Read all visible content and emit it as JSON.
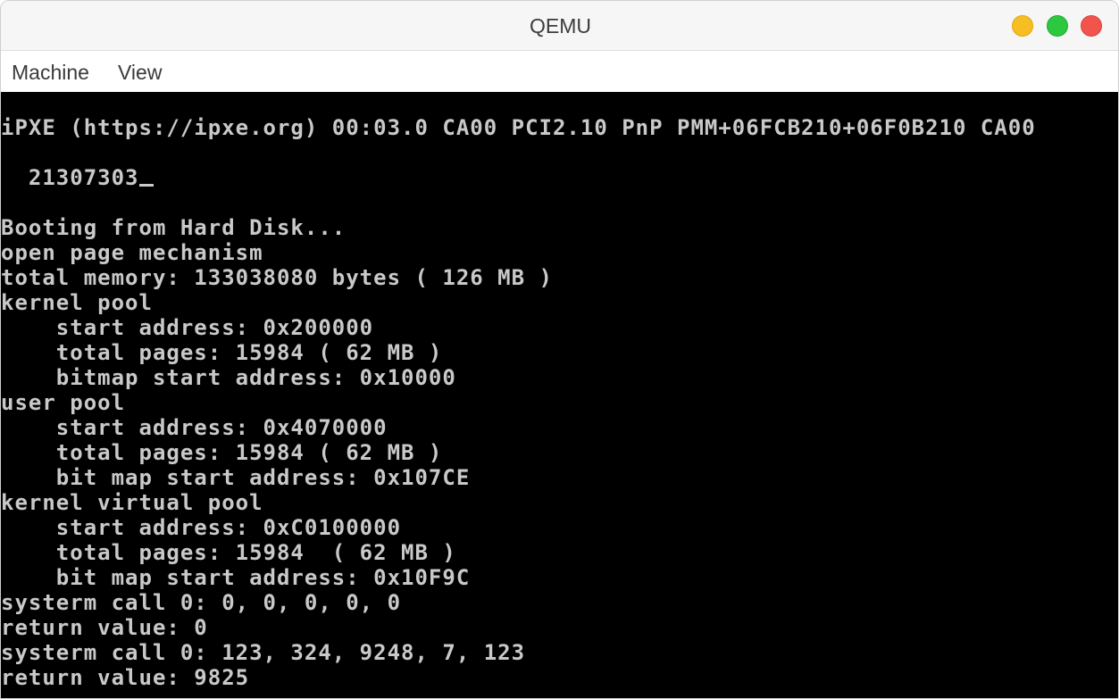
{
  "window": {
    "title": "QEMU"
  },
  "menubar": {
    "items": [
      {
        "label": "Machine"
      },
      {
        "label": "View"
      }
    ]
  },
  "console": {
    "lines": [
      "iPXE (https://ipxe.org) 00:03.0 CA00 PCI2.10 PnP PMM+06FCB210+06F0B210 CA00",
      "  21307303",
      "Booting from Hard Disk...",
      "open page mechanism",
      "total memory: 133038080 bytes ( 126 MB )",
      "kernel pool",
      "    start address: 0x200000",
      "    total pages: 15984 ( 62 MB )",
      "    bitmap start address: 0x10000",
      "user pool",
      "    start address: 0x4070000",
      "    total pages: 15984 ( 62 MB )",
      "    bit map start address: 0x107CE",
      "kernel virtual pool",
      "    start address: 0xC0100000",
      "    total pages: 15984  ( 62 MB )",
      "    bit map start address: 0x10F9C",
      "systerm call 0: 0, 0, 0, 0, 0",
      "return value: 0",
      "systerm call 0: 123, 324, 9248, 7, 123",
      "return value: 9825"
    ]
  },
  "colors": {
    "screen_bg": "#000000",
    "screen_text": "#c9c9c9",
    "minimize": "#f6be22",
    "maximize": "#2bc840",
    "close": "#f2544b"
  }
}
